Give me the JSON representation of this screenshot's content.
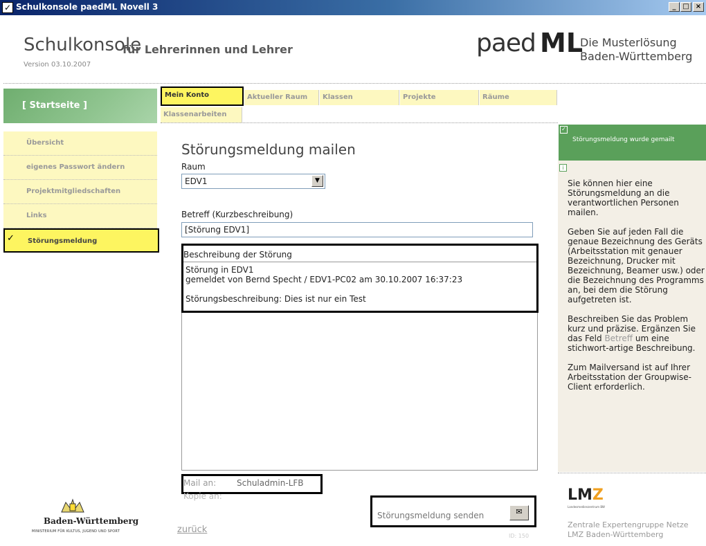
{
  "window": {
    "title": "Schulkonsole paedML Novell 3",
    "buttons": [
      "_",
      "□",
      "×"
    ]
  },
  "header": {
    "app_title": "Schulkonsole",
    "app_subtitle": "für Lehrerinnen und Lehrer",
    "version": "Version 03.10.2007",
    "logo_prefix": "paed",
    "logo_suffix": "ML",
    "slogan_line1": "Die Musterlösung",
    "slogan_line2": "Baden-Württemberg"
  },
  "nav": {
    "home": "[ Startseite ]",
    "items": [
      {
        "label": "Übersicht"
      },
      {
        "label": "eigenes Passwort ändern"
      },
      {
        "label": "Projektmitgliedschaften"
      },
      {
        "label": "Links"
      },
      {
        "label": "Störungsmeldung"
      }
    ]
  },
  "tabs": [
    "Mein Konto",
    "Aktueller Raum",
    "Klassen",
    "Projekte",
    "Räume",
    "Klassenarbeiten"
  ],
  "main": {
    "heading": "Störungsmeldung mailen",
    "raum_label": "Raum",
    "raum_value": "EDV1",
    "betreff_label": "Betreff (Kurzbeschreibung)",
    "betreff_value": "[Störung EDV1]",
    "beschreibung_label": "Beschreibung der Störung",
    "beschreibung_text": "Störung in EDV1\ngemeldet von Bernd Specht / EDV1-PC02 am 30.10.2007 16:37:23\n\nStörungsbeschreibung: Dies ist nur ein Test",
    "mail_label": "Mail an:",
    "mail_value": "Schuladmin-LFB",
    "kopie_label": "Kopie an:",
    "send_label": "Störungsmeldung senden",
    "back_link": "zurück",
    "id_text": "ID: 150"
  },
  "right": {
    "status_text": "Störungsmeldung wurde gemailt",
    "info_p1": "Sie können hier eine Störungsmeldung an die verantwortlichen Personen mailen.",
    "info_p2": "Geben Sie auf jeden Fall die genaue Bezeichnung des Geräts (Arbeitsstation mit genauer Bezeichnung, Drucker mit Bezeichnung, Beamer usw.) oder die Bezeichnung des Programms an, bei dem die Störung aufgetreten ist.",
    "info_p3_a": "Beschreiben Sie das Problem kurz und präzise. Ergänzen Sie das Feld ",
    "info_p3_link": "Betreff",
    "info_p3_b": " um eine stichwort-artige Beschreibung.",
    "info_p4": "Zum Mailversand ist auf Ihrer Arbeitsstation der Groupwise-Client erforderlich.",
    "lmz_logo_l": "LM",
    "lmz_logo_z": "Z",
    "lmz_tag": "Landesmedienzentrum BW",
    "footer1": "Zentrale Expertengruppe Netze",
    "footer2": "LMZ Baden-Württemberg"
  },
  "footer_left": {
    "state_name": "Baden-Württemberg",
    "ministry": "MINISTERIUM FÜR KULTUS, JUGEND UND SPORT"
  },
  "colors": {
    "accent_green": "#5aa05a",
    "tab_yellow": "#fdf8c0",
    "active_yellow": "#fdf560"
  }
}
